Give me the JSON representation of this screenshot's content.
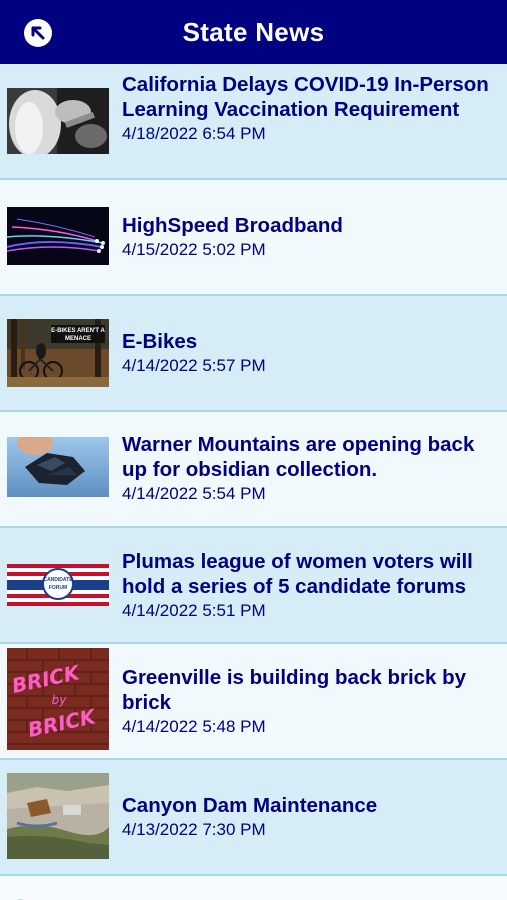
{
  "header": {
    "title": "State News",
    "back_icon": "arrow-up-left-icon"
  },
  "colors": {
    "header_bg": "#000080",
    "text": "#000080",
    "row_a": "#d6ecf6",
    "row_b": "#f2f9fc",
    "divider": "#a9d8ec"
  },
  "articles": [
    {
      "title": "California Delays COVID-19 In-Person Learning Vaccination Requirement",
      "date": "4/18/2022 6:54 PM",
      "thumb": "vaccination-photo"
    },
    {
      "title": "HighSpeed Broadband",
      "date": "4/15/2022 5:02 PM",
      "thumb": "fiber-optic-photo"
    },
    {
      "title": "E-Bikes",
      "date": "4/14/2022 5:57 PM",
      "thumb": "e-bike-photo",
      "thumb_caption": "E-BIKES AREN'T A MENACE"
    },
    {
      "title": "Warner Mountains are opening back up for obsidian collection.",
      "date": "4/14/2022 5:54 PM",
      "thumb": "obsidian-photo"
    },
    {
      "title": "Plumas league of women voters will hold a series of 5 candidate forums",
      "date": "4/14/2022 5:51 PM",
      "thumb": "candidate-forum-graphic",
      "thumb_caption": "CANDIDATE FORUM"
    },
    {
      "title": "Greenville is building back brick by brick",
      "date": "4/14/2022 5:48 PM",
      "thumb": "brick-by-brick-graphic",
      "thumb_caption": "BRICK by BRICK"
    },
    {
      "title": "Canyon Dam  Maintenance",
      "date": "4/13/2022 7:30 PM",
      "thumb": "canyon-dam-photo"
    }
  ]
}
